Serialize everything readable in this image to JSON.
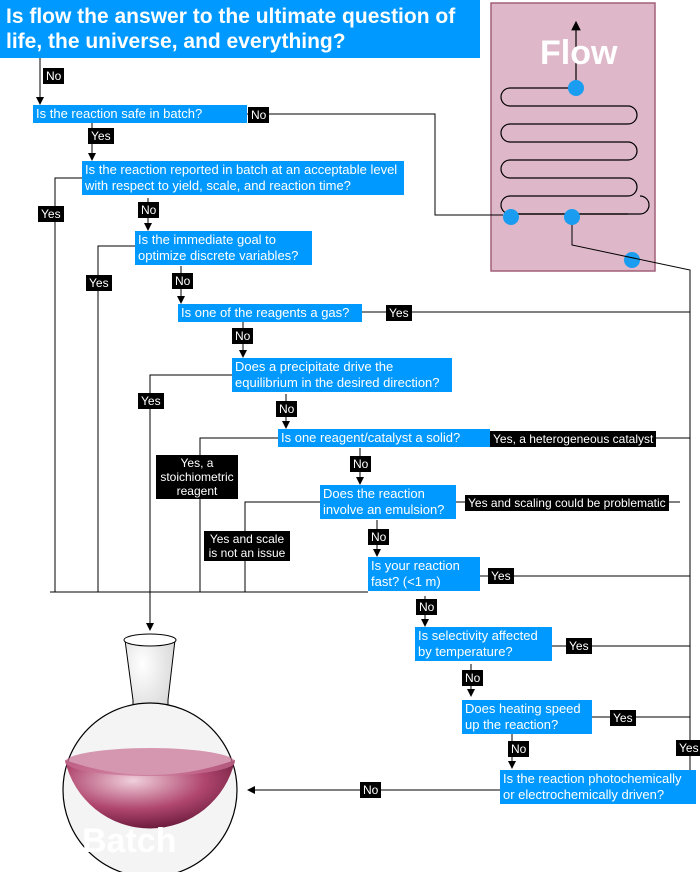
{
  "title": "Is flow the answer to the ultimate question of life, the universe, and everything?",
  "flow_label": "Flow",
  "batch_label": "Batch",
  "questions": [
    "Is the reaction safe in batch?",
    "Is the reaction reported in batch at an acceptable level with respect to yield, scale, and reaction time?",
    "Is the immediate goal to optimize discrete variables?",
    "Is one of the reagents a gas?",
    "Does a precipitate drive the equilibrium in the desired direction?",
    "Is one reagent/catalyst a solid?",
    "Does the reaction involve an emulsion?",
    "Is your reaction fast? (<1 m)",
    "Is selectivity affected by temperature?",
    "Does heating speed up the reaction?",
    "Is the reaction photochemically or electrochemically driven?"
  ],
  "labels": {
    "no": "No",
    "yes": "Yes",
    "hetero": "Yes, a heterogeneous catalyst",
    "stoich": "Yes, a stoichiometric reagent",
    "emulsion_scale": "Yes and scaling could be problematic",
    "emulsion_noscale": "Yes and scale is not an issue"
  },
  "colors": {
    "question_bg": "#0099ff",
    "label_bg": "#000000",
    "reactor_fill": "#deb8c8",
    "flask_liquid": "#b0466e",
    "node": "#1a9cf0"
  }
}
